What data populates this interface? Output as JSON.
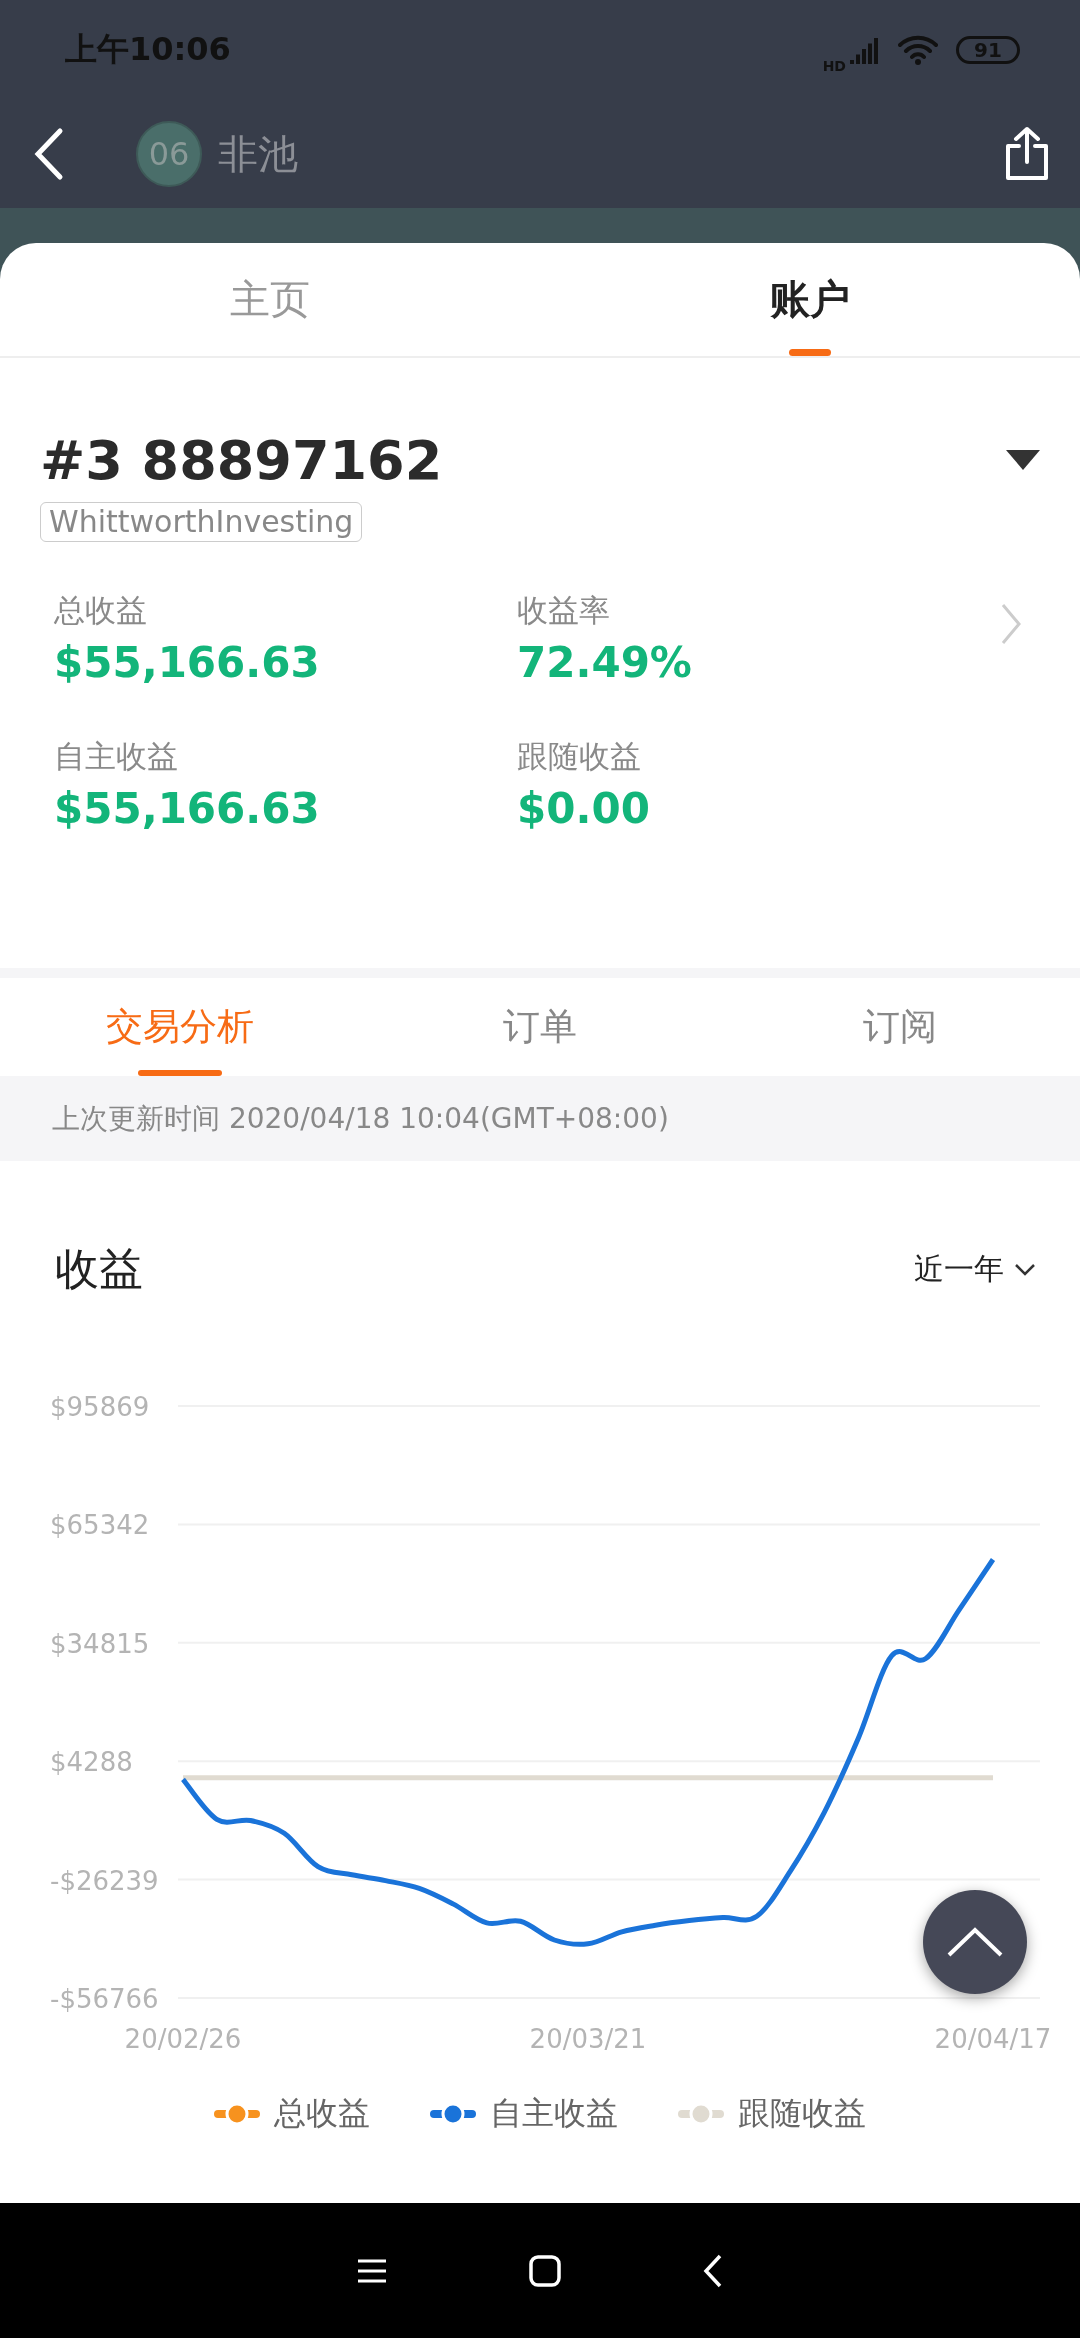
{
  "status_bar": {
    "time": "上午10:06",
    "network": "HD",
    "battery": "91"
  },
  "header": {
    "avatar": "06",
    "name": "非池"
  },
  "tabs": [
    {
      "label": "主页",
      "selected": false
    },
    {
      "label": "账户",
      "selected": true
    }
  ],
  "account": {
    "number": "#3 88897162",
    "tag": "WhittworthInvesting",
    "stats": [
      {
        "label": "总收益",
        "value": "$55,166.63"
      },
      {
        "label": "收益率",
        "value": "72.49%"
      },
      {
        "label": "自主收益",
        "value": "$55,166.63"
      },
      {
        "label": "跟随收益",
        "value": "$0.00"
      }
    ]
  },
  "sub_tabs": [
    {
      "label": "交易分析",
      "selected": true
    },
    {
      "label": "订单",
      "selected": false
    },
    {
      "label": "订阅",
      "selected": false
    }
  ],
  "update_time": "上次更新时间 2020/04/18 10:04(GMT+08:00)",
  "profit": {
    "title": "收益",
    "period": "近一年",
    "chart_data": {
      "type": "line",
      "grid": true,
      "categories": [
        "20/02/26",
        null,
        null,
        null,
        null,
        null,
        null,
        null,
        null,
        null,
        null,
        null,
        "20/03/21",
        null,
        null,
        null,
        null,
        null,
        null,
        null,
        null,
        null,
        null,
        null,
        "20/04/17"
      ],
      "series": [
        {
          "name": "总收益",
          "color": "#f7921e",
          "values": [
            null,
            null,
            null,
            null,
            null,
            null,
            null,
            null,
            null,
            null,
            null,
            null,
            null,
            null,
            null,
            null,
            null,
            null,
            null,
            null,
            null,
            null,
            null,
            null,
            null
          ]
        },
        {
          "name": "自主收益",
          "color": "#1a73d9",
          "values": [
            -400,
            -10700,
            -11000,
            -14300,
            -22900,
            -25000,
            -26500,
            -28500,
            -32500,
            -37400,
            -37000,
            -41800,
            -42800,
            -39700,
            -38000,
            -36800,
            -36000,
            -35700,
            -24000,
            -8900,
            10000,
            31500,
            30700,
            43350,
            56300
          ]
        },
        {
          "name": "跟随收益",
          "color": "#e0dbd1",
          "values": [
            0,
            0,
            0,
            0,
            0,
            0,
            0,
            0,
            0,
            0,
            0,
            0,
            0,
            0,
            0,
            0,
            0,
            0,
            0,
            0,
            0,
            0,
            0,
            0,
            0
          ]
        }
      ],
      "ylim": [
        -56766,
        95869
      ],
      "yticks": [
        {
          "value": 95869,
          "label": "$95869"
        },
        {
          "value": 65342,
          "label": "$65342"
        },
        {
          "value": 34815,
          "label": "$34815"
        },
        {
          "value": 4288,
          "label": "$4288"
        },
        {
          "value": -26239,
          "label": "-$26239"
        },
        {
          "value": -56766,
          "label": "-$56766"
        }
      ]
    }
  }
}
